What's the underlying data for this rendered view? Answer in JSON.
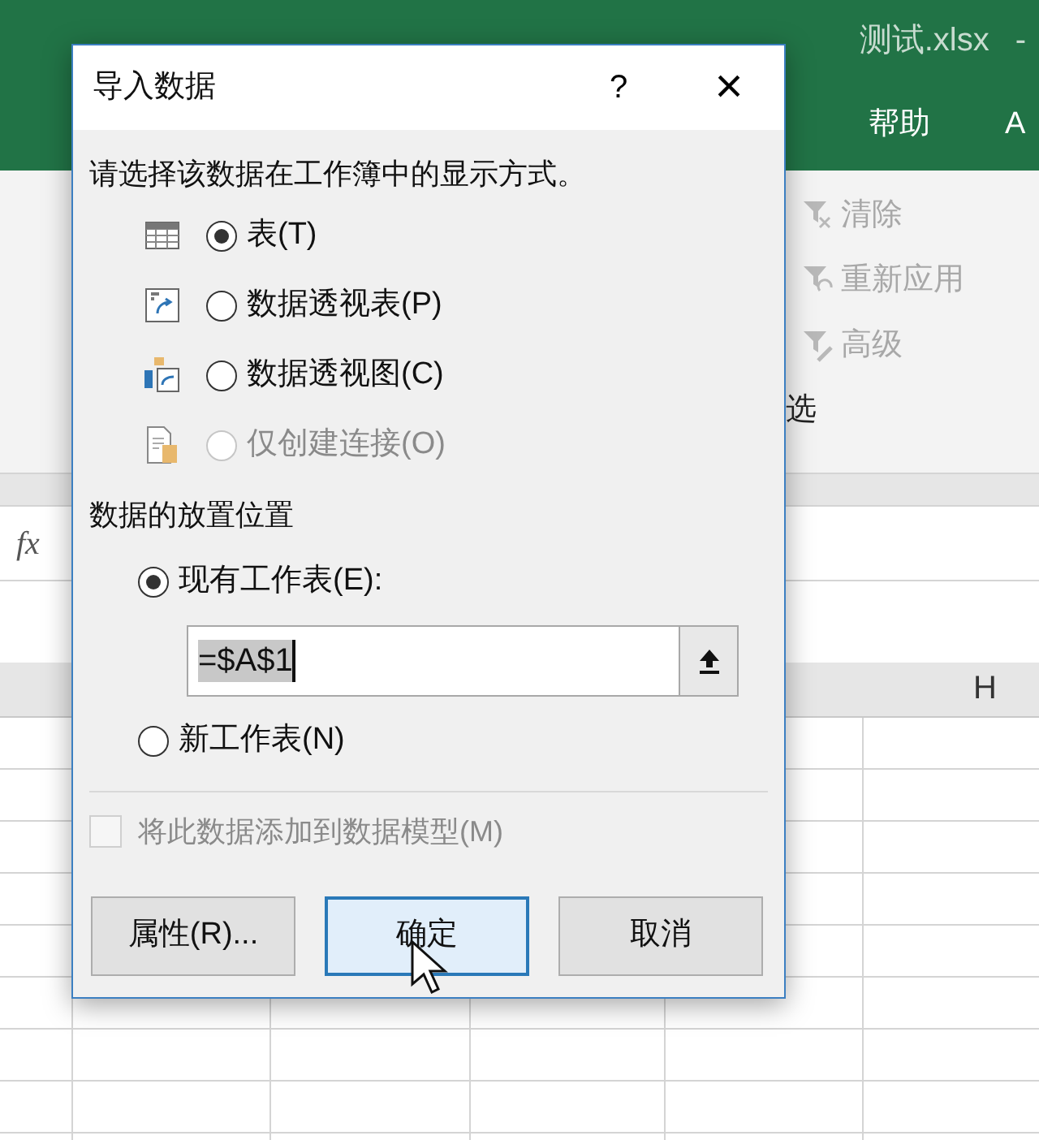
{
  "window": {
    "title": "测试.xlsx",
    "title_suffix": "-"
  },
  "ribbon_tabs": [
    {
      "label": "帮助"
    },
    {
      "label": "A"
    }
  ],
  "ribbon_commands": [
    {
      "label": "清除",
      "kind": "clear",
      "disabled": true
    },
    {
      "label": "重新应用",
      "kind": "reapply",
      "disabled": true
    },
    {
      "label": "高级",
      "kind": "advanced",
      "disabled": true
    }
  ],
  "ribbon_group_label": "选",
  "formula_bar": {
    "fx": "fx"
  },
  "column_headers": [
    "H"
  ],
  "dialog": {
    "title": "导入数据",
    "help": "?",
    "close": "×",
    "view_prompt": "请选择该数据在工作簿中的显示方式。",
    "view_options": [
      {
        "label": "表(T)",
        "kind": "table",
        "selected": true,
        "disabled": false
      },
      {
        "label": "数据透视表(P)",
        "kind": "pivot-table",
        "selected": false,
        "disabled": false
      },
      {
        "label": "数据透视图(C)",
        "kind": "pivot-chart",
        "selected": false,
        "disabled": false
      },
      {
        "label": "仅创建连接(O)",
        "kind": "connection",
        "selected": false,
        "disabled": true
      }
    ],
    "placement_heading": "数据的放置位置",
    "placement_options": [
      {
        "label": "现有工作表(E):",
        "selected": true,
        "has_field": true
      },
      {
        "label": "新工作表(N)",
        "selected": false,
        "has_field": false
      }
    ],
    "range_field": {
      "value": "=$A$1"
    },
    "data_model": {
      "label": "将此数据添加到数据模型(M)",
      "checked": false,
      "disabled": true
    },
    "buttons": [
      {
        "label": "属性(R)...",
        "default": false
      },
      {
        "label": "确定",
        "default": true
      },
      {
        "label": "取消",
        "default": false
      }
    ]
  }
}
